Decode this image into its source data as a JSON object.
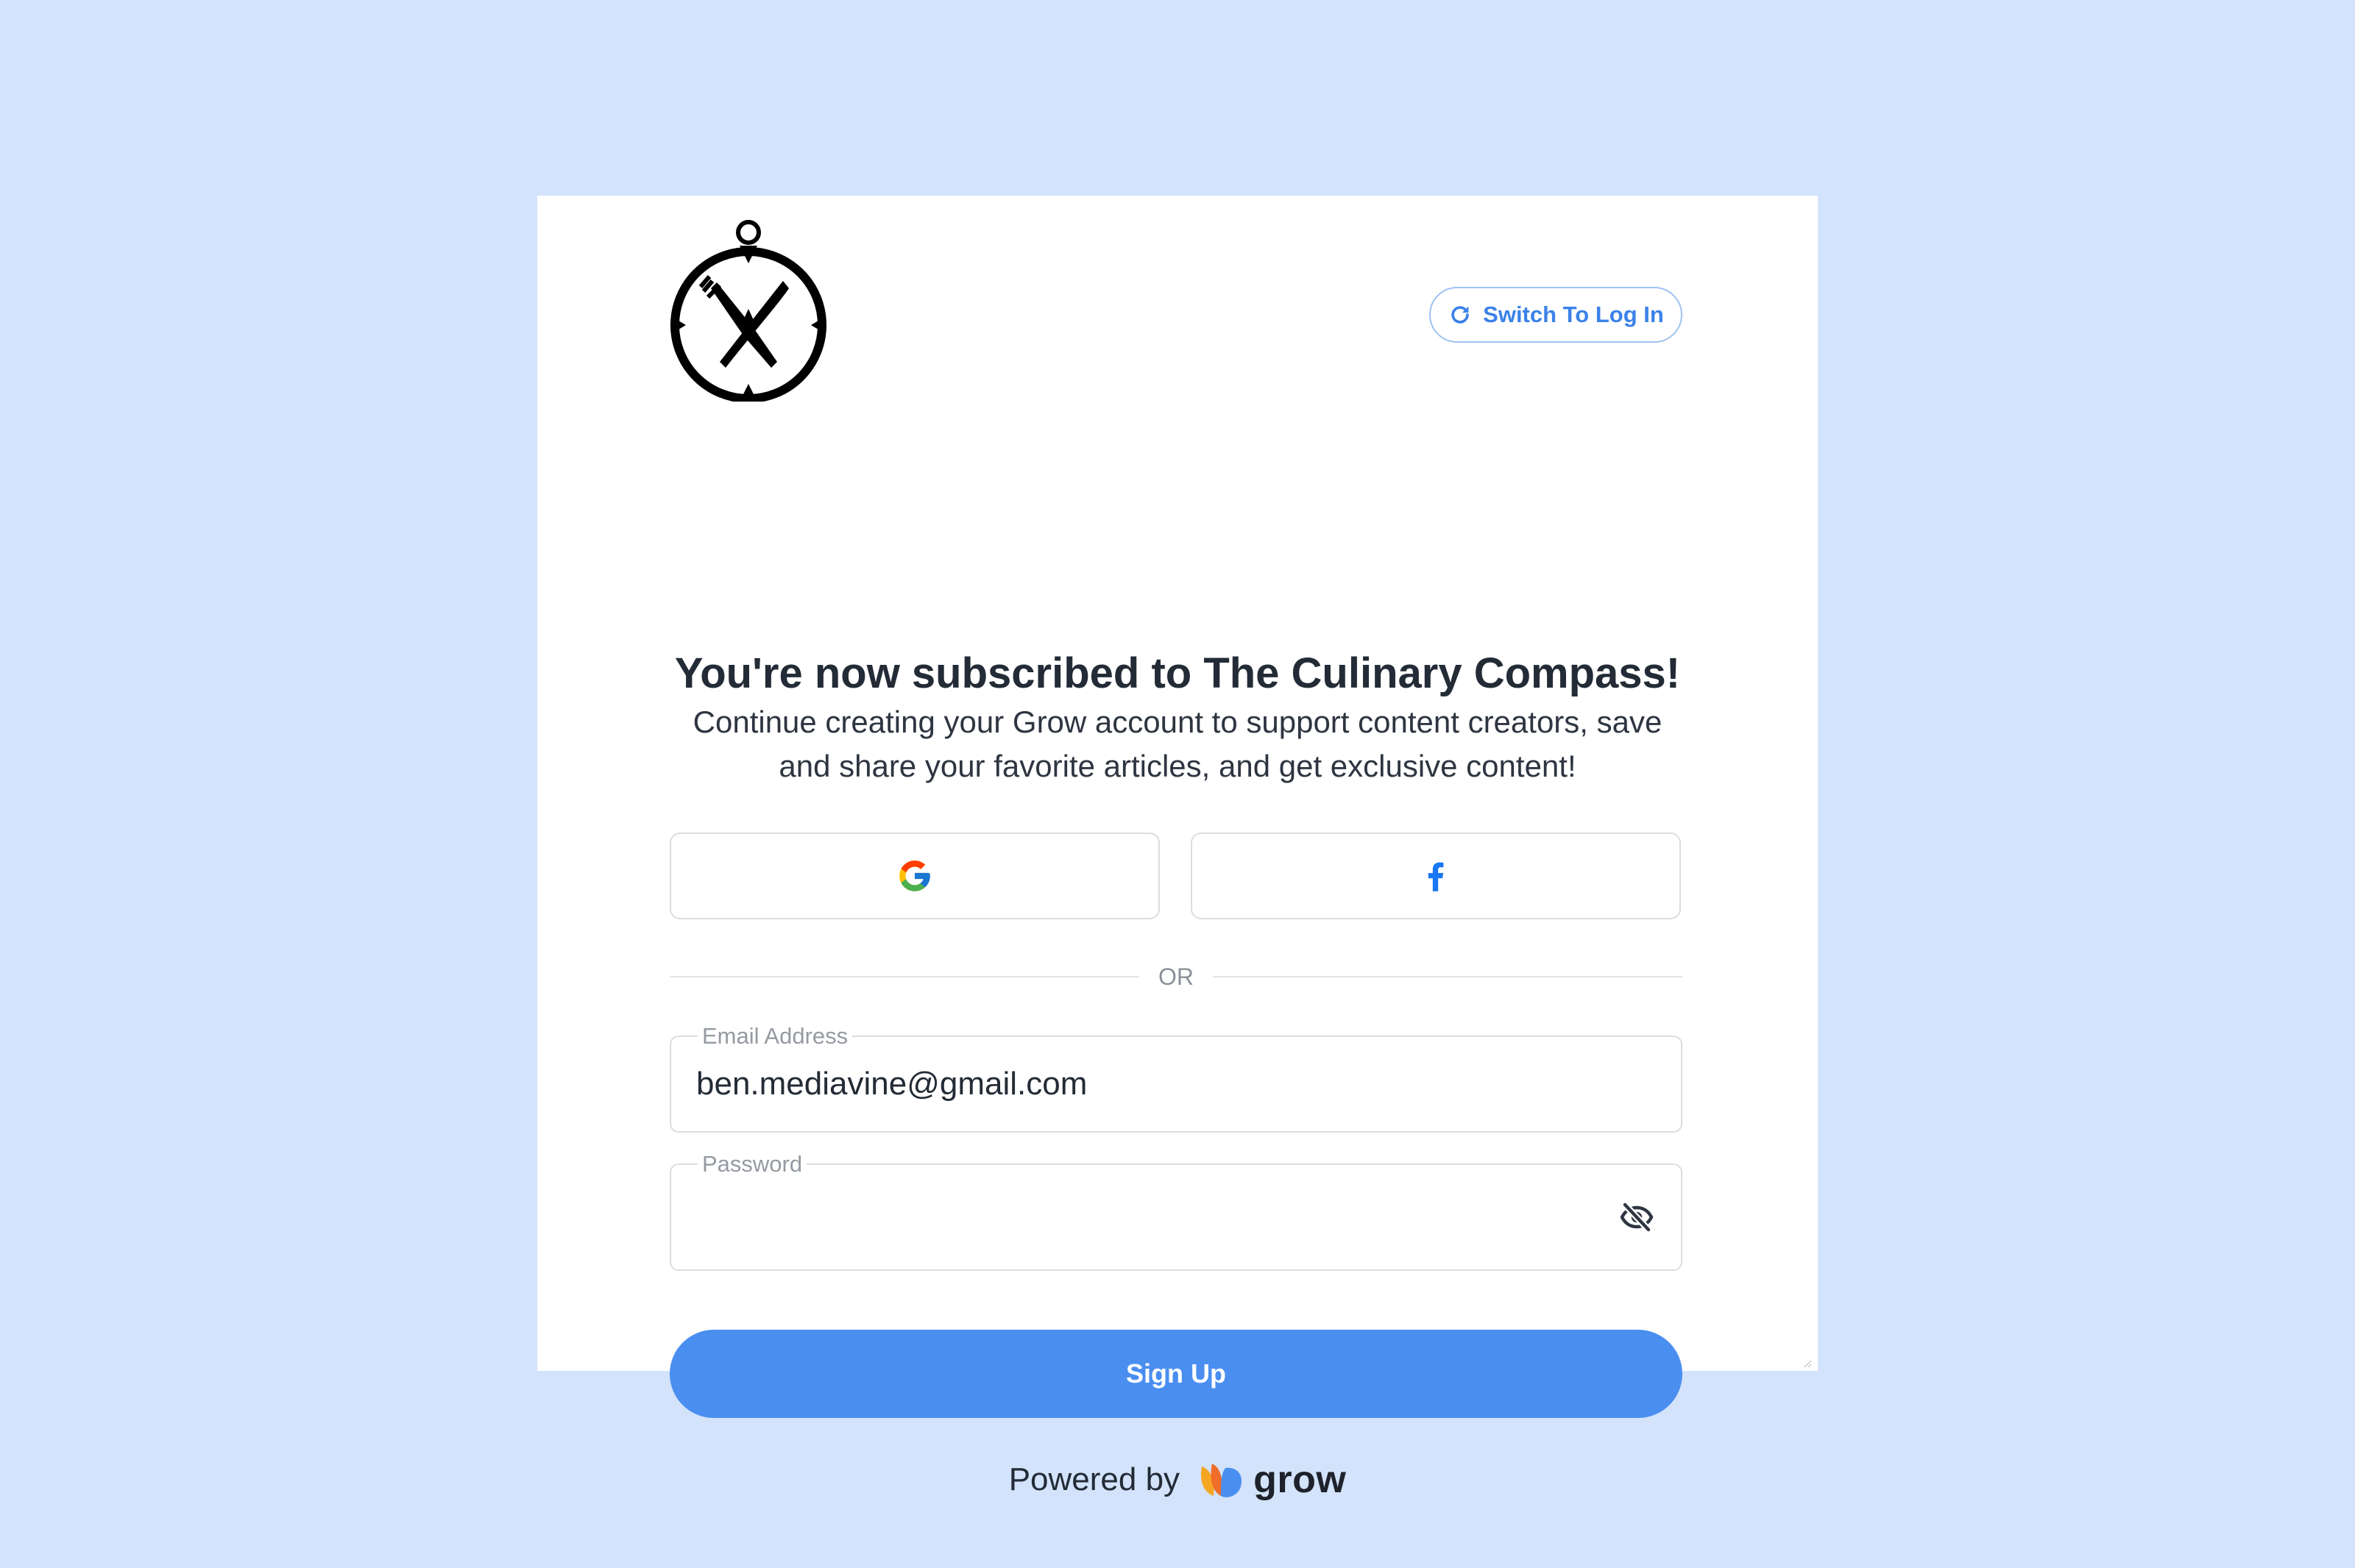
{
  "brand": {
    "logo_icon": "compass-fork-knife-icon"
  },
  "header": {
    "switch_label": "Switch To Log In",
    "switch_icon": "refresh-icon"
  },
  "content": {
    "headline": "You're now subscribed to The Culinary Compass!",
    "subtext": "Continue creating your Grow account to support content creators, save and share your favorite articles, and get exclusive content!"
  },
  "social": {
    "google_icon": "google-icon",
    "facebook_icon": "facebook-icon"
  },
  "divider": {
    "label": "OR"
  },
  "form": {
    "email": {
      "label": "Email Address",
      "value": "ben.mediavine@gmail.com"
    },
    "password": {
      "label": "Password",
      "value": "",
      "toggle_icon": "eye-slash-icon"
    },
    "submit_label": "Sign Up"
  },
  "footer": {
    "powered_by": "Powered by",
    "grow_word": "grow"
  },
  "colors": {
    "page_background": "#d3e3fb",
    "accent": "#4a8ef0",
    "text": "#232b36"
  }
}
